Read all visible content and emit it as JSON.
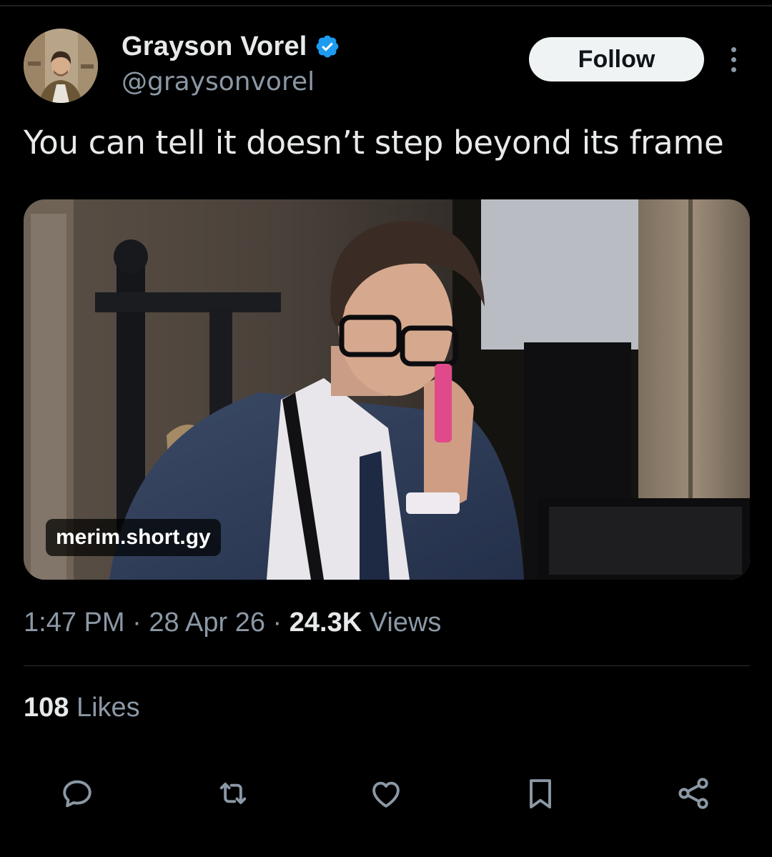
{
  "author": {
    "display_name": "Grayson Vorel",
    "handle": "@graysonvorel",
    "verified_icon": "verified-badge-icon",
    "verified_color": "#1d9bf0"
  },
  "header": {
    "follow_label": "Follow",
    "more_icon": "more-options-icon"
  },
  "tweet": {
    "text": "You can tell it doesn’t step beyond its frame"
  },
  "media": {
    "link_label": "merim.short.gy"
  },
  "meta": {
    "time": "1:47 PM",
    "sep1": " · ",
    "date": "28 Apr 26",
    "sep2": " · ",
    "views_count": "24.3K",
    "views_label": " Views"
  },
  "stats": {
    "likes_count": "108",
    "likes_label": " Likes"
  },
  "actions": [
    {
      "icon": "reply-icon"
    },
    {
      "icon": "retweet-icon"
    },
    {
      "icon": "like-icon"
    },
    {
      "icon": "bookmark-icon"
    },
    {
      "icon": "share-icon"
    }
  ],
  "colors": {
    "background": "#000000",
    "primary_text": "#e7e9ea",
    "secondary_text": "#8b98a5",
    "follow_bg": "#eff3f4",
    "divider": "#2f3336"
  }
}
